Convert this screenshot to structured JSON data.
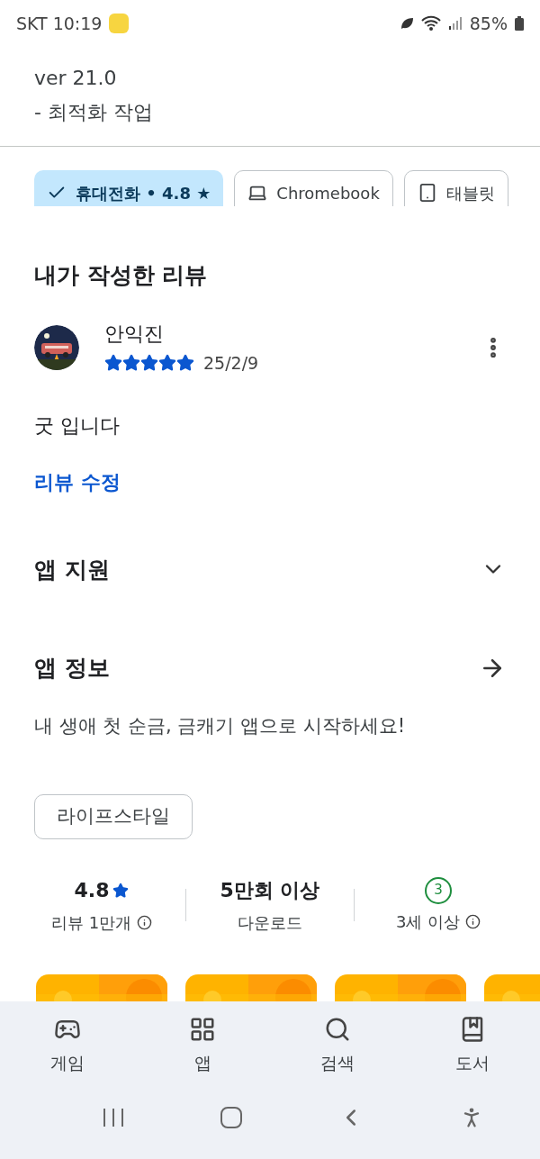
{
  "status_bar": {
    "carrier_time": "SKT 10:19",
    "battery": "85%"
  },
  "whats_new": [
    "ver 21.0",
    "- 최적화 작업"
  ],
  "device_chips": [
    {
      "label": "휴대전화 • 4.8 ★",
      "kind": "phone",
      "selected": true
    },
    {
      "label": "Chromebook",
      "kind": "laptop",
      "selected": false
    },
    {
      "label": "태블릿",
      "kind": "tablet",
      "selected": false
    }
  ],
  "my_review": {
    "heading": "내가 작성한 리뷰",
    "author": "안익진",
    "stars": 5,
    "date": "25/2/9",
    "text": "굿 입니다",
    "edit_link": "리뷰 수정"
  },
  "app_support": {
    "title": "앱 지원",
    "expanded": false
  },
  "app_info": {
    "title": "앱 정보",
    "description": "내 생애 첫 순금, 금캐기 앱으로 시작하세요!",
    "category": "라이프스타일"
  },
  "stats": [
    {
      "kind": "rating",
      "value": "4.8",
      "label": "리뷰 1만개"
    },
    {
      "kind": "plain",
      "value": "5만회 이상",
      "label": "다운로드"
    },
    {
      "kind": "age",
      "value": "3",
      "label": "3세 이상"
    }
  ],
  "screenshots": [
    {
      "kind": "picture"
    },
    {
      "kind": "picture"
    },
    {
      "kind": "picture"
    },
    {
      "kind": "picture"
    }
  ],
  "bottom_nav": [
    {
      "label": "게임",
      "kind": "games"
    },
    {
      "label": "앱",
      "kind": "apps"
    },
    {
      "label": "검색",
      "kind": "search"
    },
    {
      "label": "도서",
      "kind": "books"
    }
  ]
}
